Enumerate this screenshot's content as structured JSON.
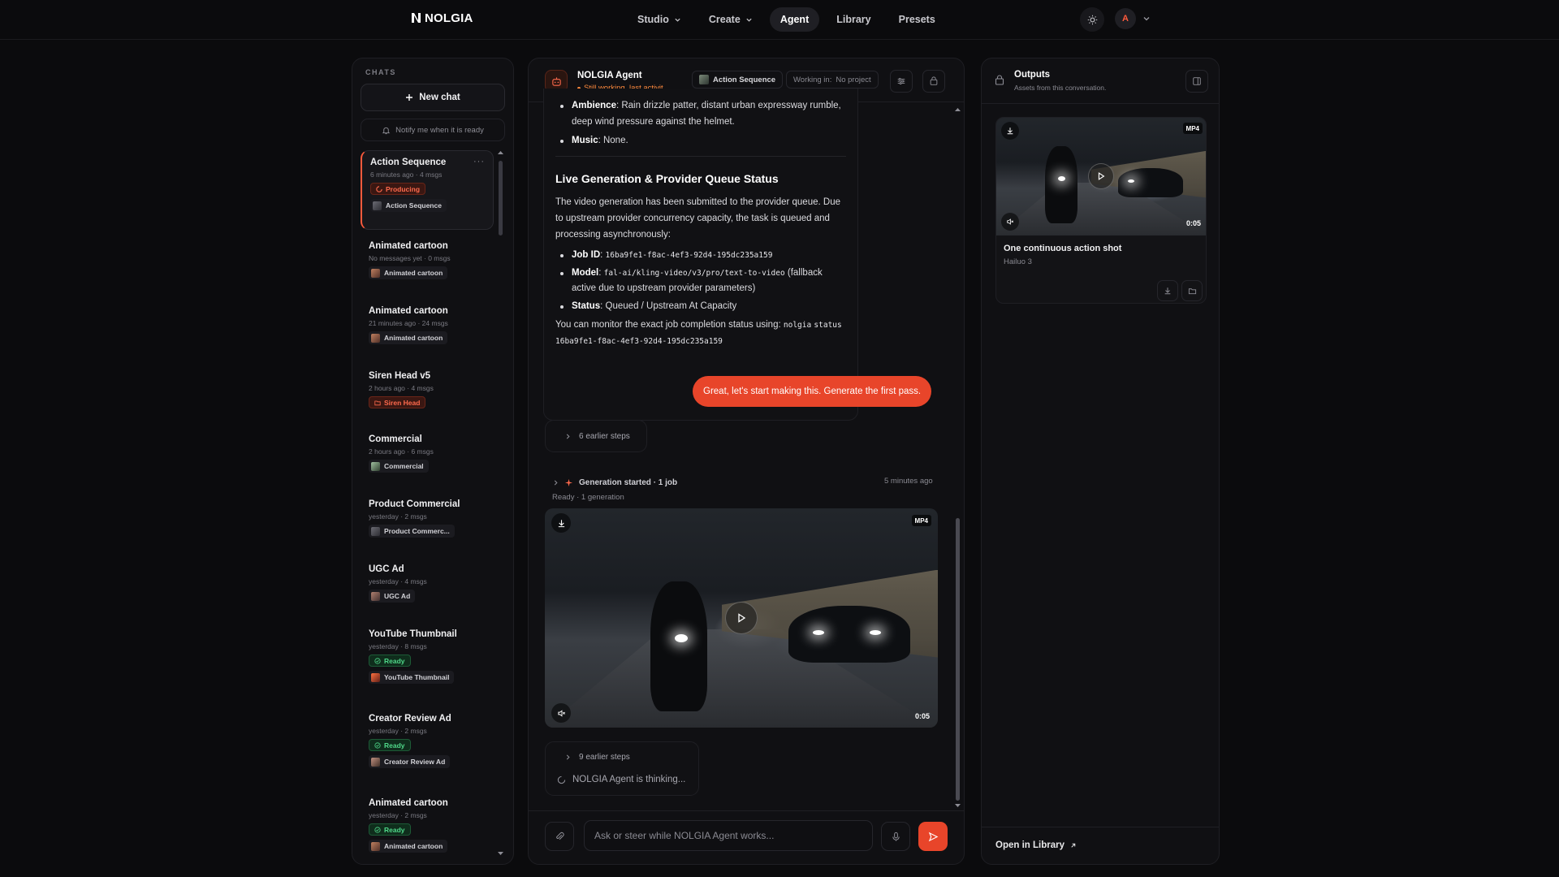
{
  "brand": {
    "name": "NOLGIA"
  },
  "nav": {
    "items": [
      {
        "label": "Studio",
        "dropdown": true,
        "active": false
      },
      {
        "label": "Create",
        "dropdown": true,
        "active": false
      },
      {
        "label": "Agent",
        "dropdown": false,
        "active": true
      },
      {
        "label": "Library",
        "dropdown": false,
        "active": false
      },
      {
        "label": "Presets",
        "dropdown": false,
        "active": false
      }
    ],
    "avatar_initial": "A",
    "theme_icon": "sun-icon"
  },
  "sidebar": {
    "section_label": "CHATS",
    "new_chat_label": "New chat",
    "notify_label": "Notify me when it is ready",
    "chats": [
      {
        "title": "Action Sequence",
        "meta": "6 minutes ago · 4 msgs",
        "status": "Producing",
        "tag": "Action Sequence",
        "active": true
      },
      {
        "title": "Animated cartoon",
        "meta": "No messages yet · 0 msgs",
        "status": "",
        "tag": "Animated cartoon"
      },
      {
        "title": "Animated cartoon",
        "meta": "21 minutes ago · 24 msgs",
        "status": "",
        "tag": "Animated cartoon"
      },
      {
        "title": "Siren Head v5",
        "meta": "2 hours ago · 4 msgs",
        "status": "",
        "tag": "Siren Head"
      },
      {
        "title": "Commercial",
        "meta": "2 hours ago · 6 msgs",
        "status": "",
        "tag": "Commercial"
      },
      {
        "title": "Product Commercial",
        "meta": "yesterday · 2 msgs",
        "status": "",
        "tag": "Product Commerc..."
      },
      {
        "title": "UGC Ad",
        "meta": "yesterday · 4 msgs",
        "status": "",
        "tag": "UGC Ad"
      },
      {
        "title": "YouTube Thumbnail",
        "meta": "yesterday · 8 msgs",
        "status": "Ready",
        "tag": "YouTube Thumbnail"
      },
      {
        "title": "Creator Review Ad",
        "meta": "yesterday · 2 msgs",
        "status": "Ready",
        "tag": "Creator Review Ad"
      },
      {
        "title": "Animated cartoon",
        "meta": "yesterday · 2 msgs",
        "status": "Ready",
        "tag": "Animated cartoon"
      }
    ]
  },
  "chat": {
    "agent_name": "NOLGIA Agent",
    "agent_status": "Still working, last activit...",
    "project_chip": "Action Sequence",
    "working_in_label": "Working in:",
    "working_in_value": "No project",
    "message": {
      "ambience_label": "Ambience",
      "ambience_text": ": Rain drizzle patter, distant urban expressway rumble, deep wind pressure against the helmet.",
      "music_label": "Music",
      "music_text": ": None.",
      "heading": "Live Generation & Provider Queue Status",
      "para1": "The video generation has been submitted to the provider queue. Due to upstream provider concurrency capacity, the task is queued and processing asynchronously:",
      "job_label": "Job ID",
      "job_value": "16ba9fe1-f8ac-4ef3-92d4-195dc235a159",
      "model_label": "Model",
      "model_value": "fal-ai/kling-video/v3/pro/text-to-video",
      "model_note": "(fallback active due to upstream provider parameters)",
      "status_label": "Status",
      "status_value": ": Queued / Upstream At Capacity",
      "monitor_text": "You can monitor the exact job completion status using:",
      "monitor_cmd_1": "nolgia",
      "monitor_cmd_2": "status 16ba9fe1-f8ac-4ef3-92d4-195dc235a159"
    },
    "user_message": "Great, let's start making this. Generate the first pass.",
    "earlier_steps_1": "6 earlier steps",
    "generation_label": "Generation started · 1 job",
    "generation_time": "5 minutes ago",
    "generation_sub": "Ready · 1 generation",
    "video": {
      "format": "MP4",
      "duration": "0:05"
    },
    "earlier_steps_2": "9 earlier steps",
    "thinking_label": "NOLGIA Agent is thinking...",
    "composer_placeholder": "Ask or steer while NOLGIA Agent works..."
  },
  "outputs": {
    "title": "Outputs",
    "subtitle": "Assets from this conversation.",
    "card": {
      "format": "MP4",
      "duration": "0:05",
      "title": "One continuous action shot",
      "model": "Hailuo 3"
    },
    "open_library_label": "Open in Library"
  },
  "colors": {
    "accent": "#e8452a",
    "background": "#0b0b0d",
    "panel": "#101013",
    "ready": "#4fd889",
    "producing": "#ff6a4d"
  }
}
